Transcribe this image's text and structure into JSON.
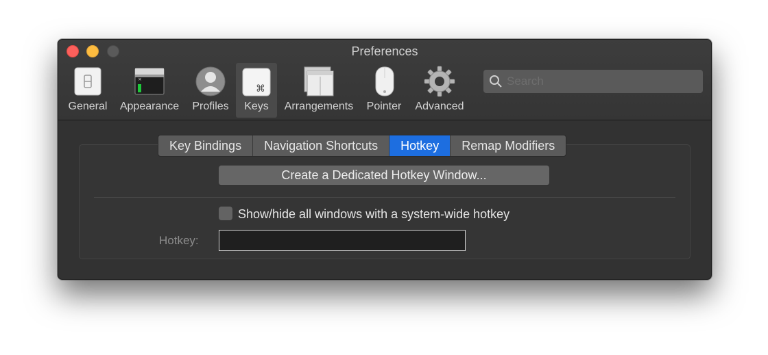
{
  "window": {
    "title": "Preferences"
  },
  "toolbar": {
    "items": [
      {
        "label": "General",
        "icon": "general-icon"
      },
      {
        "label": "Appearance",
        "icon": "appearance-icon"
      },
      {
        "label": "Profiles",
        "icon": "profiles-icon"
      },
      {
        "label": "Keys",
        "icon": "keys-icon",
        "selected": true
      },
      {
        "label": "Arrangements",
        "icon": "arrangements-icon"
      },
      {
        "label": "Pointer",
        "icon": "pointer-icon"
      },
      {
        "label": "Advanced",
        "icon": "gear-icon"
      }
    ],
    "keys_glyph": "⌘"
  },
  "search": {
    "placeholder": "Search",
    "value": ""
  },
  "tabs": {
    "items": [
      "Key Bindings",
      "Navigation Shortcuts",
      "Hotkey",
      "Remap Modifiers"
    ],
    "active": "Hotkey"
  },
  "hotkey_pane": {
    "create_button": "Create a Dedicated Hotkey Window...",
    "checkbox_label": "Show/hide all windows with a system-wide hotkey",
    "checkbox_checked": false,
    "hotkey_label": "Hotkey:",
    "hotkey_value": ""
  },
  "colors": {
    "accent": "#1d6ee0",
    "window_bg": "#323232",
    "close": "#fc605c",
    "minimize": "#fdbc40"
  }
}
